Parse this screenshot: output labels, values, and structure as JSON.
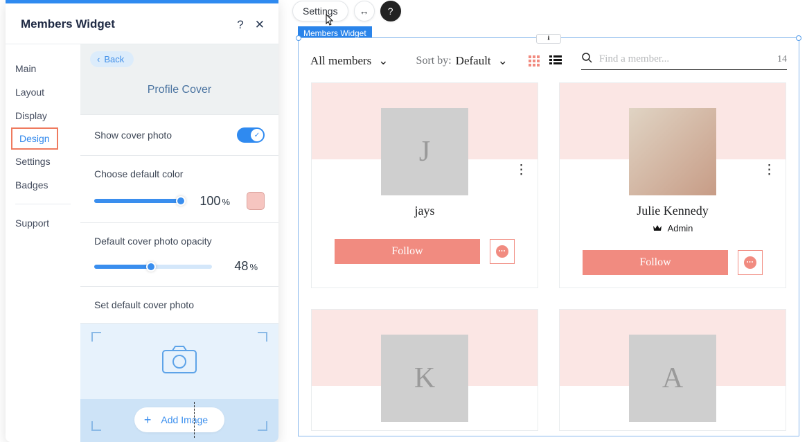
{
  "panel": {
    "title": "Members Widget",
    "back": "Back",
    "section_title": "Profile Cover",
    "sidebar": {
      "items": [
        "Main",
        "Layout",
        "Display",
        "Design",
        "Settings",
        "Badges"
      ],
      "support": "Support",
      "active": "Design"
    },
    "show_cover": {
      "label": "Show cover photo",
      "on": true
    },
    "default_color": {
      "label": "Choose default color",
      "value": 100,
      "unit": "%",
      "swatch": "#f6c5c0"
    },
    "opacity": {
      "label": "Default cover photo opacity",
      "value": 48,
      "unit": "%"
    },
    "set_default_photo_label": "Set default cover photo",
    "add_image": "Add Image"
  },
  "top": {
    "settings": "Settings",
    "widget_tag": "Members Widget"
  },
  "preview": {
    "filter": "All members",
    "sortby_label": "Sort by:",
    "sortby_value": "Default",
    "search_placeholder": "Find a member...",
    "count": "14",
    "follow": "Follow",
    "admin_label": "Admin",
    "cards": [
      {
        "name": "jays",
        "initial": "J",
        "has_photo": false,
        "role": null
      },
      {
        "name": "Julie Kennedy",
        "initial": "",
        "has_photo": true,
        "role": "Admin"
      },
      {
        "name": "",
        "initial": "K",
        "has_photo": false,
        "role": null
      },
      {
        "name": "",
        "initial": "A",
        "has_photo": false,
        "role": null
      }
    ]
  }
}
